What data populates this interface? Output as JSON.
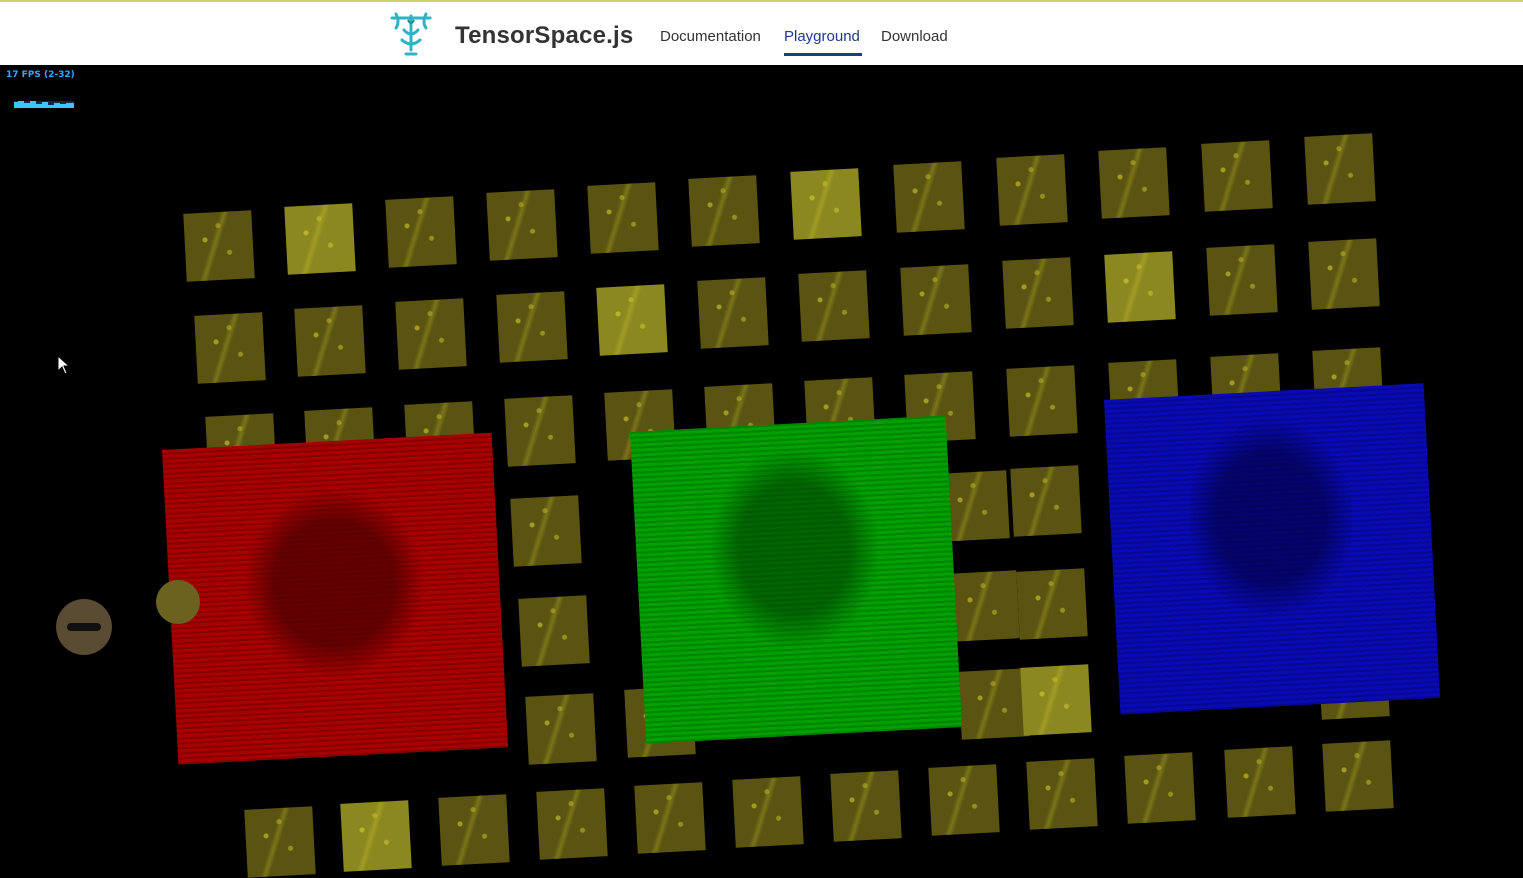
{
  "header": {
    "brand": "TensorSpace.js",
    "nav": [
      {
        "label": "Documentation",
        "active": false
      },
      {
        "label": "Playground",
        "active": true
      },
      {
        "label": "Download",
        "active": false
      }
    ]
  },
  "stats": {
    "fps_text": "17 FPS (2-32)"
  },
  "scene": {
    "input_channels": [
      "red",
      "green",
      "blue"
    ],
    "colors": {
      "feature_map": "#5a5311",
      "feature_map_bright": "#8c8820",
      "red_channel": "#a80000",
      "green_channel": "#00a000",
      "blue_channel": "#0a0ab4",
      "nav_active": "#1d3a8a"
    },
    "controls": {
      "collapse_icon": "minus-icon"
    }
  }
}
